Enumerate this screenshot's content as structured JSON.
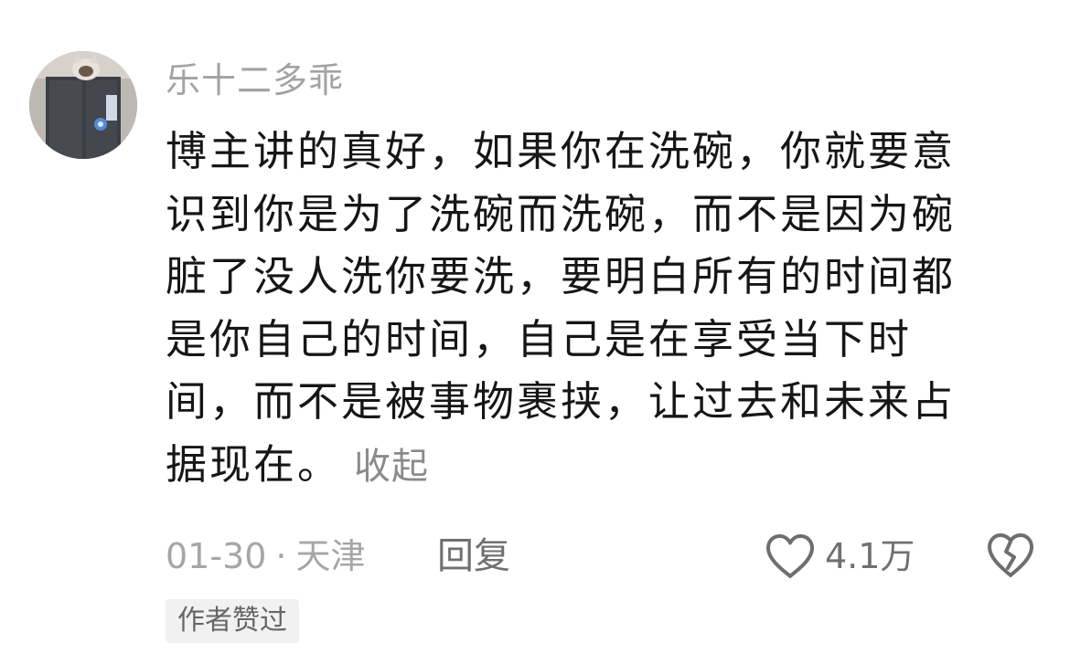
{
  "comment": {
    "username": "乐十二多乖",
    "content_lines": [
      "博主讲的真好，如果你在洗碗，你就要意",
      "识到你是为了洗碗而洗碗，而不是因为碗",
      "脏了没人洗你要洗，要明白所有的时间都",
      "是你自己的时间，自己是在享受当下时",
      "间，而不是被事物裹挟，让过去和未来占",
      "据现在。"
    ],
    "collapse_label": "收起",
    "date": "01-30",
    "separator": "·",
    "location": "天津",
    "reply_label": "回复",
    "like_count": "4.1万",
    "author_tag": "作者赞过"
  },
  "icons": {
    "like": "heart-outline-icon",
    "dislike": "broken-heart-icon"
  },
  "colors": {
    "username": "#a3a3a3",
    "body_text": "#161616",
    "meta_text": "#a6a6a6",
    "action_text": "#707070",
    "tag_background": "#f1f1f1"
  }
}
